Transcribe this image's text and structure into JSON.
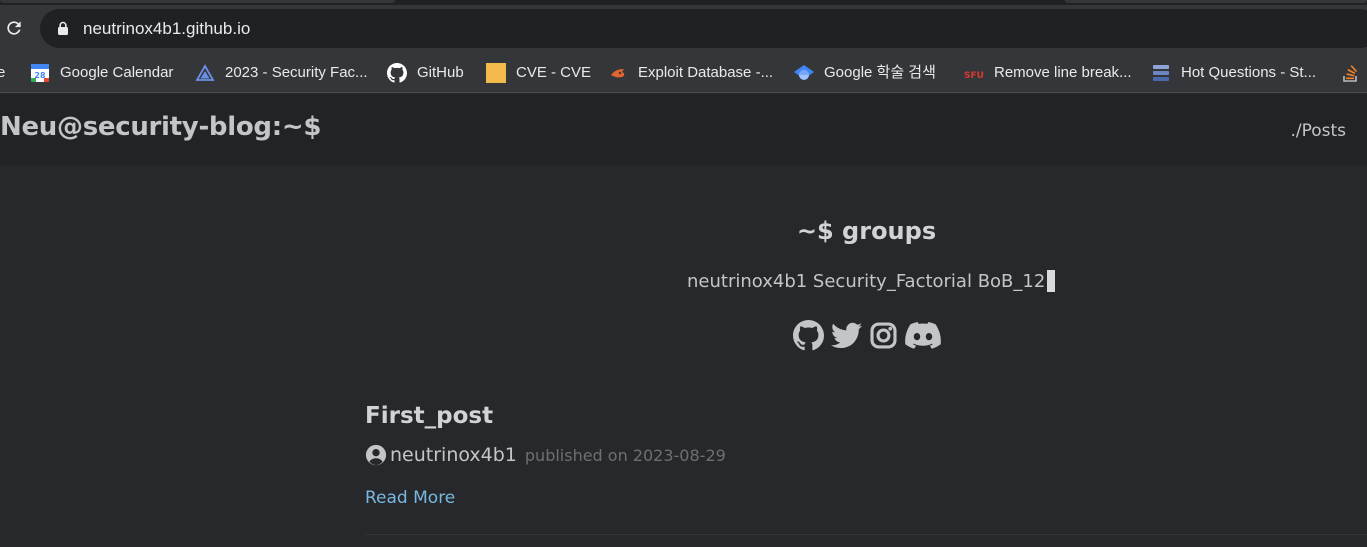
{
  "browser": {
    "url": "neutrinox4b1.github.io",
    "bookmarks": [
      {
        "label": "e",
        "icon": "truncated-bookmark-icon"
      },
      {
        "label": "Google Calendar",
        "icon": "google-calendar-icon"
      },
      {
        "label": "2023 - Security Fac...",
        "icon": "triangle-logo-icon"
      },
      {
        "label": "GitHub",
        "icon": "github-icon"
      },
      {
        "label": "CVE - CVE",
        "icon": "folder-icon"
      },
      {
        "label": "Exploit Database -...",
        "icon": "exploit-db-icon"
      },
      {
        "label": "Google 학술 검색",
        "icon": "google-scholar-icon"
      },
      {
        "label": "Remove line break...",
        "icon": "sfu-icon"
      },
      {
        "label": "Hot Questions - St...",
        "icon": "stack-icon"
      }
    ]
  },
  "site": {
    "title": "Neu@security-blog:~$",
    "nav": {
      "posts": "./Posts"
    }
  },
  "profile": {
    "heading": "~$ groups",
    "groups": "neutrinox4b1 Security_Factorial BoB_12",
    "social_icons": [
      "github-icon",
      "twitter-icon",
      "instagram-icon",
      "discord-icon"
    ]
  },
  "posts": [
    {
      "title": "First_post",
      "author": "neutrinox4b1",
      "published": "published on 2023-08-29",
      "read_more": "Read More"
    }
  ],
  "colors": {
    "page_bg": "#27282c",
    "header_bg": "#222326",
    "text": "#c4c5c8",
    "link": "#79b8e0",
    "muted": "#6e6f73"
  }
}
